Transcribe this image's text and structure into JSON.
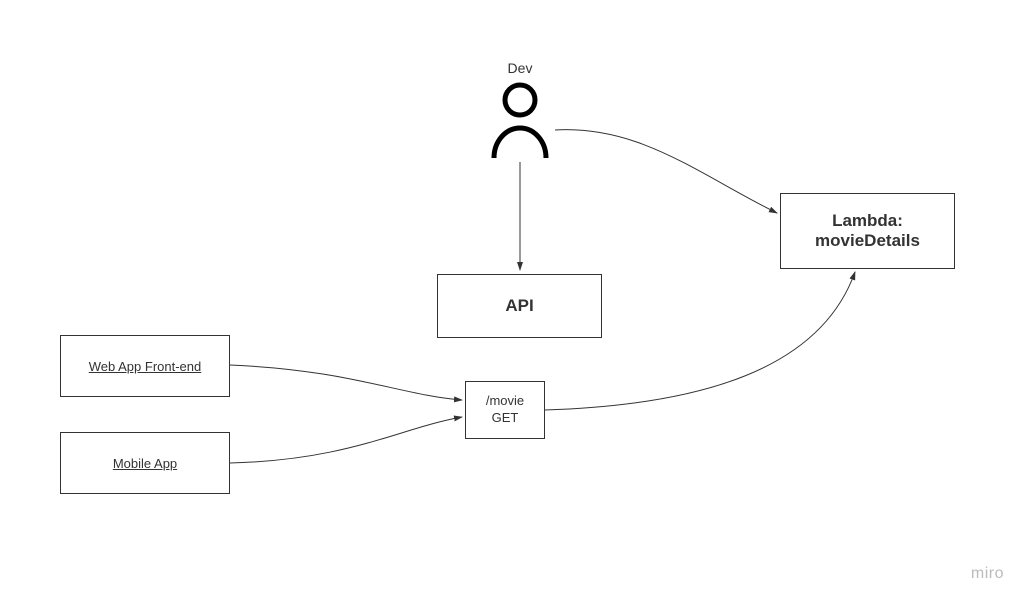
{
  "nodes": {
    "dev_label": "Dev",
    "api": "API",
    "lambda_line1": "Lambda:",
    "lambda_line2": "movieDetails",
    "web_app": "Web App Front-end",
    "mobile_app": "Mobile App",
    "endpoint_path": "/movie",
    "endpoint_method": "GET"
  },
  "watermark": "miro",
  "colors": {
    "border": "#333333",
    "text": "#333333",
    "watermark": "#bbbbbb"
  }
}
